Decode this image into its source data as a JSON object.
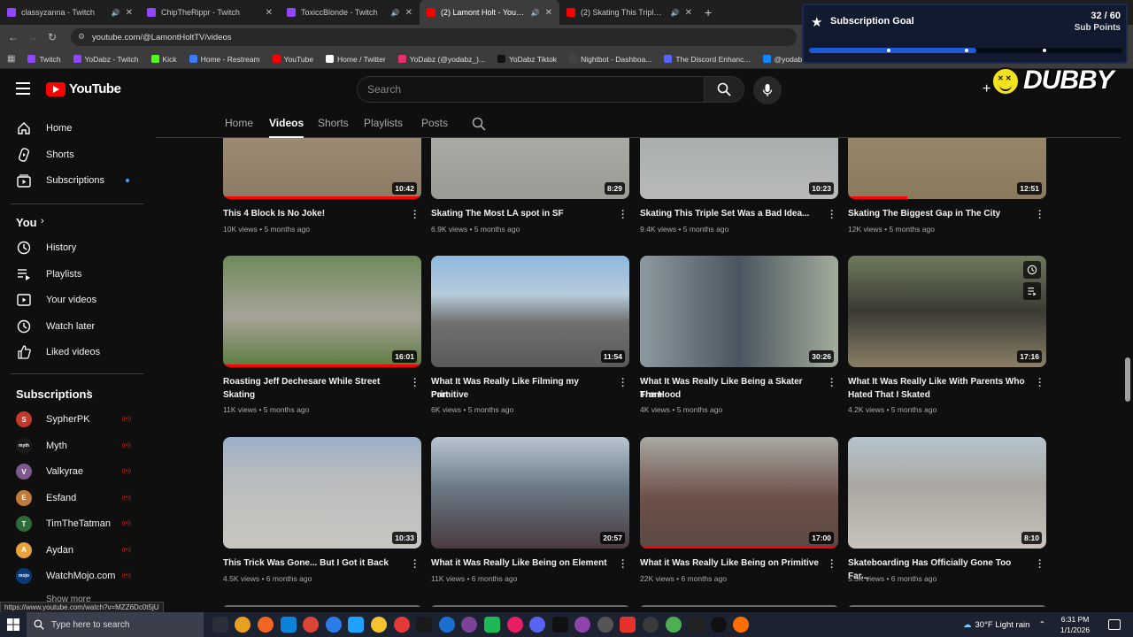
{
  "browser": {
    "tabs": [
      {
        "title": "classyzanna - Twitch",
        "color": "#9146ff",
        "active": false
      },
      {
        "title": "ChipTheRippr - Twitch",
        "color": "#9146ff",
        "active": false
      },
      {
        "title": "ToxiccBlonde - Twitch",
        "color": "#9146ff",
        "active": false
      },
      {
        "title": "(2) Lamont Holt - YouTube",
        "color": "#ff0000",
        "active": true
      },
      {
        "title": "(2) Skating This Triple Set W",
        "color": "#ff0000",
        "active": false
      }
    ],
    "url": "youtube.com/@LamontHoltTV/videos",
    "status_link": "https://www.youtube.com/watch?v=MZZ6Dc0t5jU",
    "bookmarks": [
      {
        "label": "Twitch",
        "color": "#9146ff"
      },
      {
        "label": "YoDabz - Twitch",
        "color": "#9146ff"
      },
      {
        "label": "Kick",
        "color": "#53fc18"
      },
      {
        "label": "Home - Restream",
        "color": "#3d7bf7"
      },
      {
        "label": "YouTube",
        "color": "#ff0000"
      },
      {
        "label": "Home / Twitter",
        "color": "#ffffff"
      },
      {
        "label": "YoDabz (@yodabz_)...",
        "color": "#e1306c"
      },
      {
        "label": "YoDabz Tiktok",
        "color": "#111111"
      },
      {
        "label": "Nightbot - Dashboa...",
        "color": "#444444"
      },
      {
        "label": "The Discord Enhanc...",
        "color": "#5865f2"
      },
      {
        "label": "@yodabz.bsky.socia...",
        "color": "#1185fe"
      }
    ]
  },
  "goal": {
    "title": "Subscription Goal",
    "count": "32 / 60",
    "unit": "Sub Points",
    "progress": 0.533
  },
  "overlay": {
    "brand": "DUBBY"
  },
  "header": {
    "logo_text": "YouTube",
    "search_placeholder": "Search"
  },
  "sidebar": {
    "main": [
      {
        "label": "Home",
        "icon": "home-icon"
      },
      {
        "label": "Shorts",
        "icon": "shorts-icon"
      },
      {
        "label": "Subscriptions",
        "icon": "subscriptions-icon"
      }
    ],
    "you_heading": "You",
    "you_items": [
      {
        "label": "History",
        "icon": "history-icon"
      },
      {
        "label": "Playlists",
        "icon": "playlists-icon"
      },
      {
        "label": "Your videos",
        "icon": "your-videos-icon"
      },
      {
        "label": "Watch later",
        "icon": "watch-later-icon"
      },
      {
        "label": "Liked videos",
        "icon": "liked-videos-icon"
      }
    ],
    "subs_heading": "Subscriptions",
    "subs": [
      {
        "label": "SypherPK",
        "color": "#c0392b",
        "initial": "S"
      },
      {
        "label": "Myth",
        "color": "#1a1a1a",
        "initial": "myth"
      },
      {
        "label": "Valkyrae",
        "color": "#7d5a8c",
        "initial": "V"
      },
      {
        "label": "Esfand",
        "color": "#c27a3a",
        "initial": "E"
      },
      {
        "label": "TimTheTatman",
        "color": "#2e6b3b",
        "initial": "T"
      },
      {
        "label": "Aydan",
        "color": "#e8a33c",
        "initial": "A"
      },
      {
        "label": "WatchMojo.com",
        "color": "#0a3a78",
        "initial": "mojo"
      }
    ],
    "show_more": "Show more"
  },
  "channel_tabs": [
    "Home",
    "Videos",
    "Shorts",
    "Playlists",
    "Posts"
  ],
  "videos": [
    {
      "title1": "This 4 Block Is No Joke!",
      "title2": "",
      "meta": "10K views • 5 months ago",
      "duration": "10:42",
      "watched": 1.0,
      "bg": "linear-gradient(#a69780,#8c7c66)"
    },
    {
      "title1": "Skating The Most LA spot in SF",
      "title2": "",
      "meta": "6.9K views • 5 months ago",
      "duration": "8:29",
      "watched": 0,
      "bg": "linear-gradient(#b7b8b2,#9a9b95)"
    },
    {
      "title1": "Skating This Triple Set Was a Bad Idea...",
      "title2": "",
      "meta": "9.4K views • 5 months ago",
      "duration": "10:23",
      "watched": 0,
      "bg": "linear-gradient(#9fa3a3,#b8baba)"
    },
    {
      "title1": "Skating The Biggest Gap in The City",
      "title2": "",
      "meta": "12K views • 5 months ago",
      "duration": "12:51",
      "watched": 0.3,
      "bg": "linear-gradient(#a08e6e,#8a7a5e)"
    },
    {
      "title1": "Roasting Jeff Dechesare While Street",
      "title2": "Skating",
      "meta": "11K views • 5 months ago",
      "duration": "16:01",
      "watched": 1.0,
      "bg": "linear-gradient(#6e8a5a 0%,#a7a49a 55%,#5c7a3e 100%)"
    },
    {
      "title1": "What It Was Really Like Filming my Primitive",
      "title2": "Part",
      "meta": "6K views • 5 months ago",
      "duration": "11:54",
      "watched": 0,
      "bg": "linear-gradient(#8fb9e0 0%,#b5cbd9 35%,#707070 60%,#5a5a5a 100%)"
    },
    {
      "title1": "What It Was Really Like Being a Skater From",
      "title2": "The Hood",
      "meta": "4K views • 5 months ago",
      "duration": "30:26",
      "watched": 0,
      "bg": "linear-gradient(90deg,#8c9aa0 0%,#4a5560 50%,#a3ad9c 100%)"
    },
    {
      "title1": "What It Was Really Like With Parents Who",
      "title2": "Hated That I Skated",
      "meta": "4.2K views • 5 months ago",
      "duration": "17:16",
      "watched": 0,
      "bg": "linear-gradient(#6e7a5c 0%,#3a3a34 50%,#8a7e66 100%)"
    },
    {
      "title1": "This Trick Was Gone... But I Got it Back",
      "title2": "",
      "meta": "4.5K views • 6 months ago",
      "duration": "10:33",
      "watched": 0,
      "bg": "linear-gradient(#9cb0c8 0%,#b9bcbd 35%,#c9c6c1 100%)"
    },
    {
      "title1": "What it Was Really Like Being on Element",
      "title2": "",
      "meta": "11K views • 6 months ago",
      "duration": "20:57",
      "watched": 0,
      "bg": "linear-gradient(#b9c6d1 0%,#6a7a86 45%,#4a3a40 100%)"
    },
    {
      "title1": "What it Was Really Like Being on Primitive",
      "title2": "",
      "meta": "22K views • 6 months ago",
      "duration": "17:00",
      "watched": 1.0,
      "bg": "linear-gradient(#a9a8a2 0%,#6e5048 55%,#5a4a44 100%)"
    },
    {
      "title1": "Skateboarding Has Officially Gone Too Far...",
      "title2": "",
      "meta": "5.5K views • 6 months ago",
      "duration": "8:10",
      "watched": 0,
      "bg": "linear-gradient(#b5c4cf 0%,#a9a7a0 45%,#c8c4bc 100%)"
    }
  ],
  "taskbar": {
    "search_placeholder": "Type here to search",
    "weather": "30°F  Light rain",
    "time": "6:31 PM",
    "date": "1/1/2026"
  }
}
